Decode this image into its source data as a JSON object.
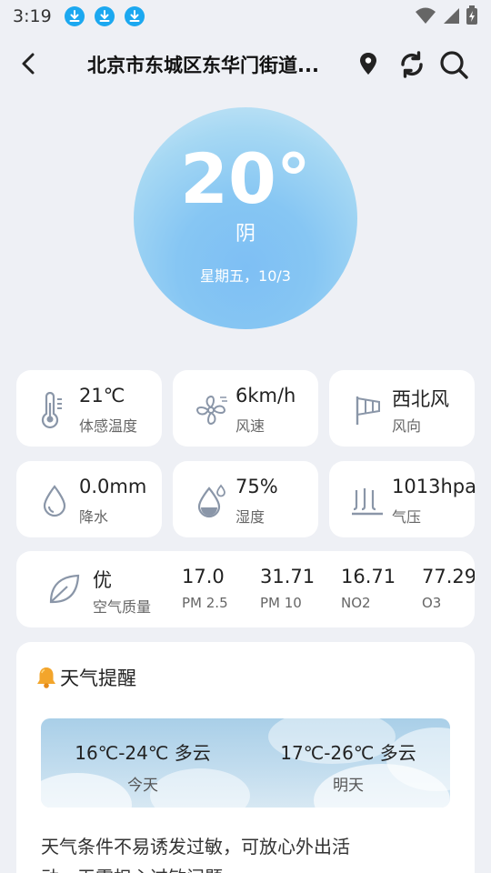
{
  "status_bar": {
    "time": "3:19"
  },
  "header": {
    "location": "北京市东城区东华门街道..."
  },
  "current": {
    "temperature": "20°",
    "condition": "阴",
    "date": "星期五，10/3"
  },
  "tiles": [
    {
      "value": "21℃",
      "label": "体感温度",
      "icon": "thermometer-icon"
    },
    {
      "value": "6km/h",
      "label": "风速",
      "icon": "fan-icon"
    },
    {
      "value": "西北风",
      "label": "风向",
      "icon": "windsock-icon"
    },
    {
      "value": "0.0mm",
      "label": "降水",
      "icon": "raindrop-icon"
    },
    {
      "value": "75%",
      "label": "湿度",
      "icon": "humidity-icon"
    },
    {
      "value": "1013hpa",
      "label": "气压",
      "icon": "pressure-icon"
    }
  ],
  "air_quality": {
    "level": "优",
    "label": "空气质量",
    "items": [
      {
        "value": "17.0",
        "label": "PM 2.5"
      },
      {
        "value": "31.71",
        "label": "PM 10"
      },
      {
        "value": "16.71",
        "label": "NO2"
      },
      {
        "value": "77.29",
        "label": "O3"
      }
    ]
  },
  "reminder": {
    "title": "天气提醒",
    "forecast": [
      {
        "temp": "16℃-24℃",
        "cond": "多云",
        "day": "今天"
      },
      {
        "temp": "17℃-26℃",
        "cond": "多云",
        "day": "明天"
      }
    ],
    "text": "天气条件不易诱发过敏，可放心外出活动，无需担心过敏问题。"
  },
  "colors": {
    "accent": "#1ba8f0",
    "icon": "#8a96a8"
  }
}
